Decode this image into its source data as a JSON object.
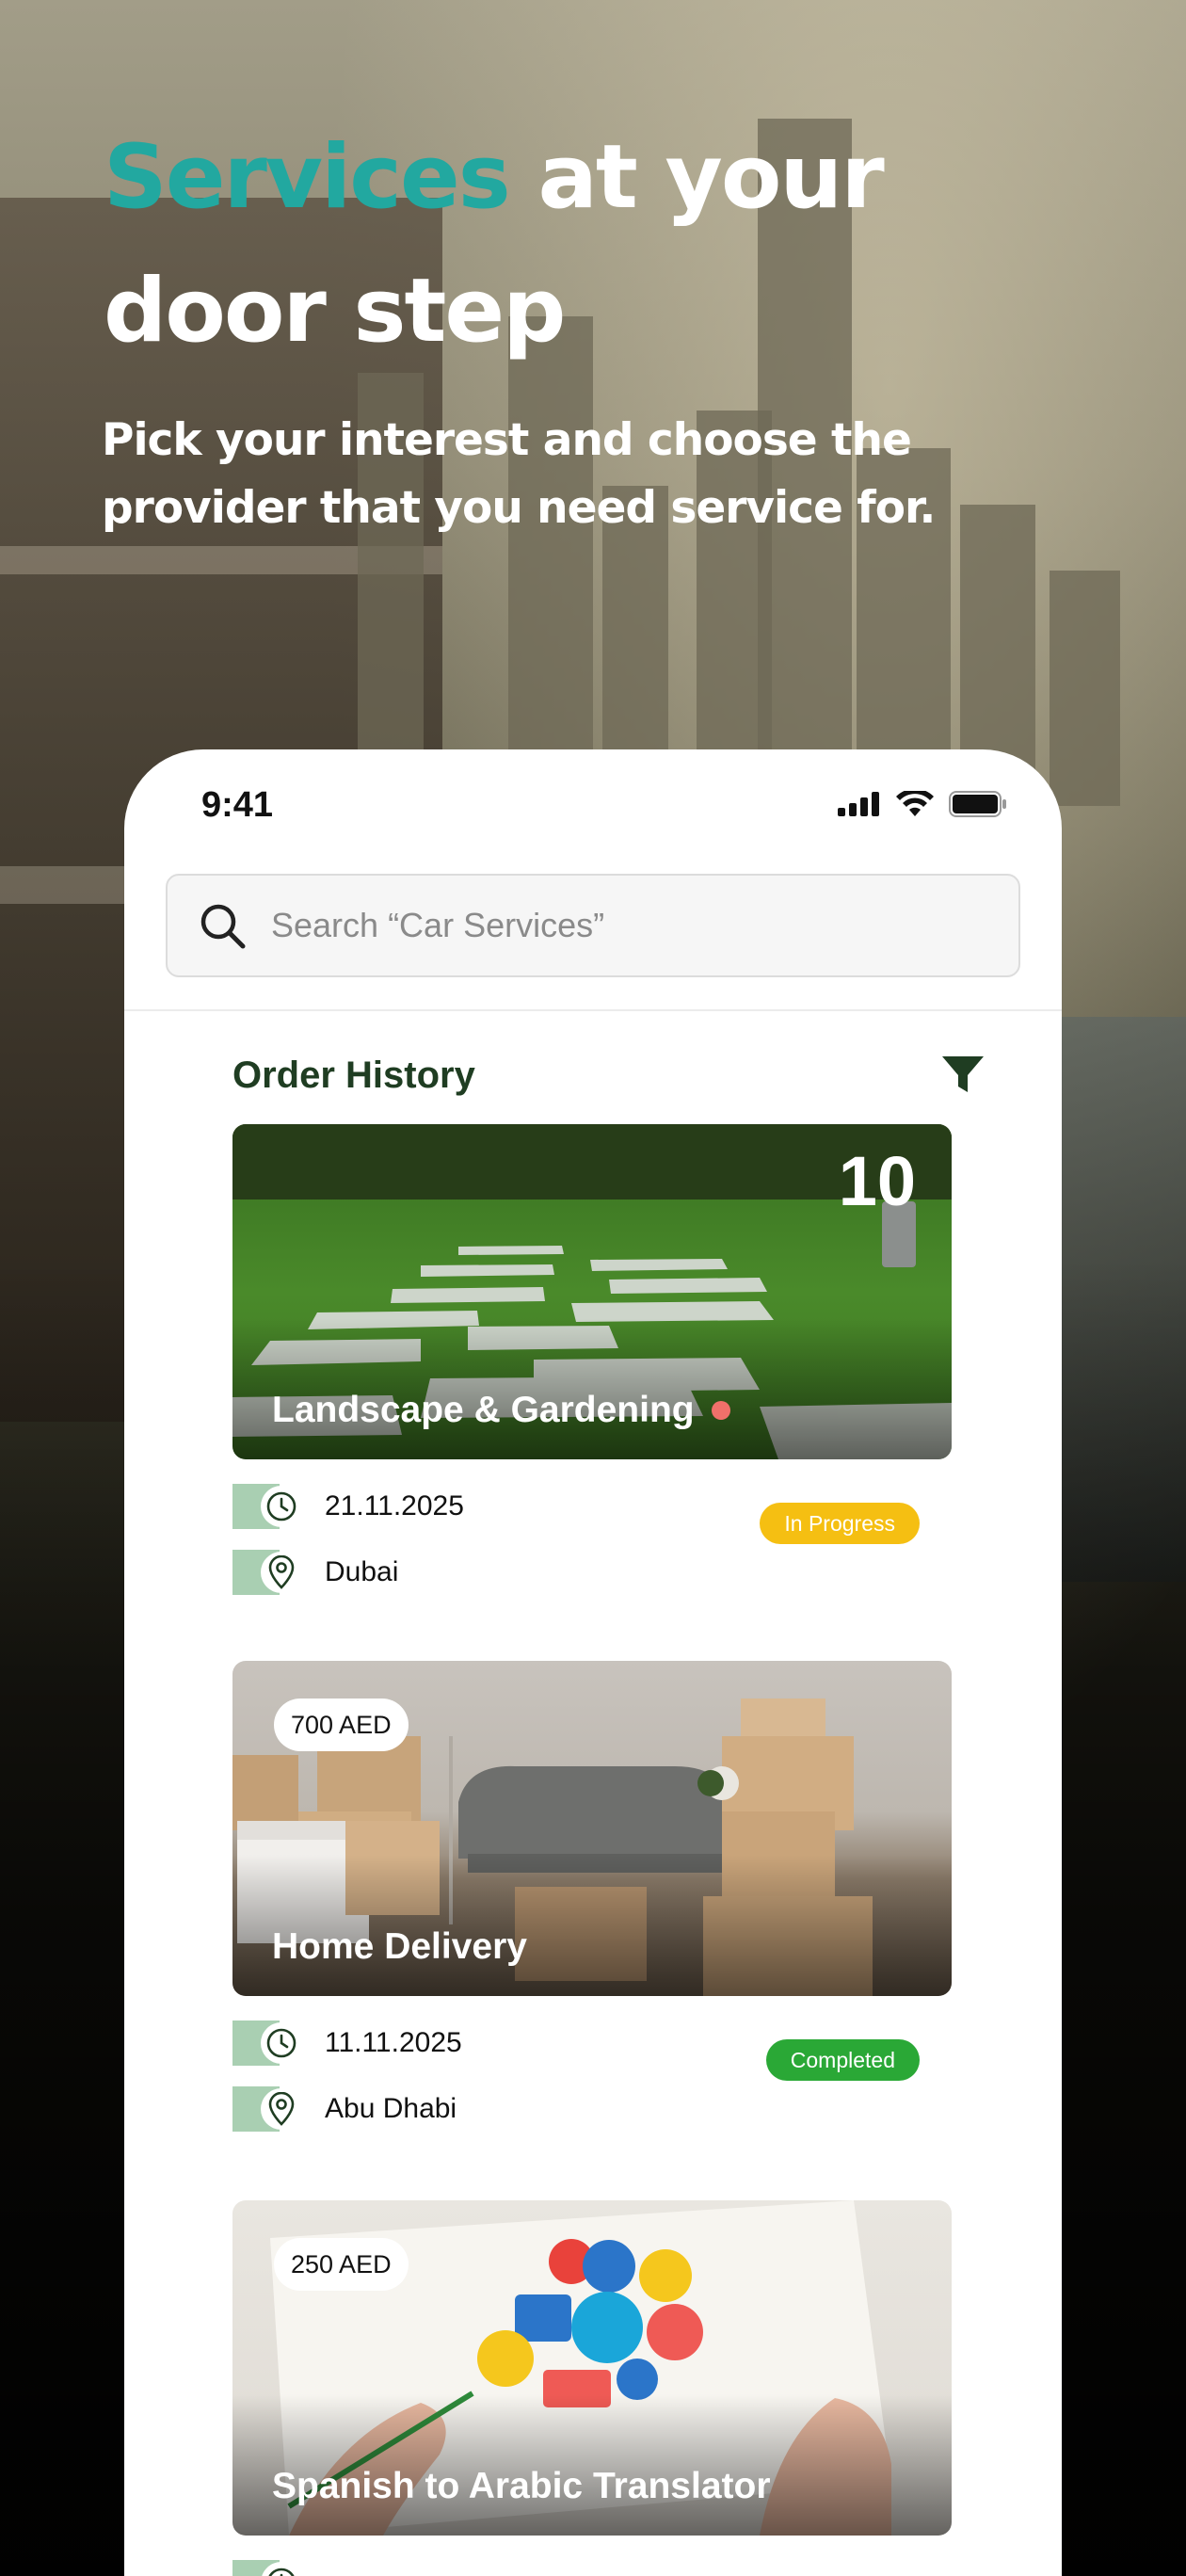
{
  "hero": {
    "title_accent": "Services",
    "title_line1_rest": " at your",
    "title_line2": "door step",
    "subtitle": "Pick your interest and choose the provider that you need service for."
  },
  "status_bar": {
    "time": "9:41"
  },
  "search": {
    "placeholder": "Search “Car Services”"
  },
  "order_history": {
    "heading": "Order History",
    "orders": [
      {
        "title": "Landscape & Gardening",
        "count": "10",
        "date": "21.11.2025",
        "location": "Dubai",
        "status": "In Progress",
        "status_color": "#f5bf12",
        "notification_dot_color": "#f0706a"
      },
      {
        "title": "Home Delivery",
        "price": "700 AED",
        "date": "11.11.2025",
        "location": "Abu Dhabi",
        "status": "Completed",
        "status_color": "#2aa836"
      },
      {
        "title": "Spanish to Arabic Translator",
        "price": "250 AED"
      }
    ]
  },
  "colors": {
    "accent_teal": "#22a8a0",
    "heading_green": "#1f3d22",
    "icon_tab_green": "#a9cfb2"
  }
}
